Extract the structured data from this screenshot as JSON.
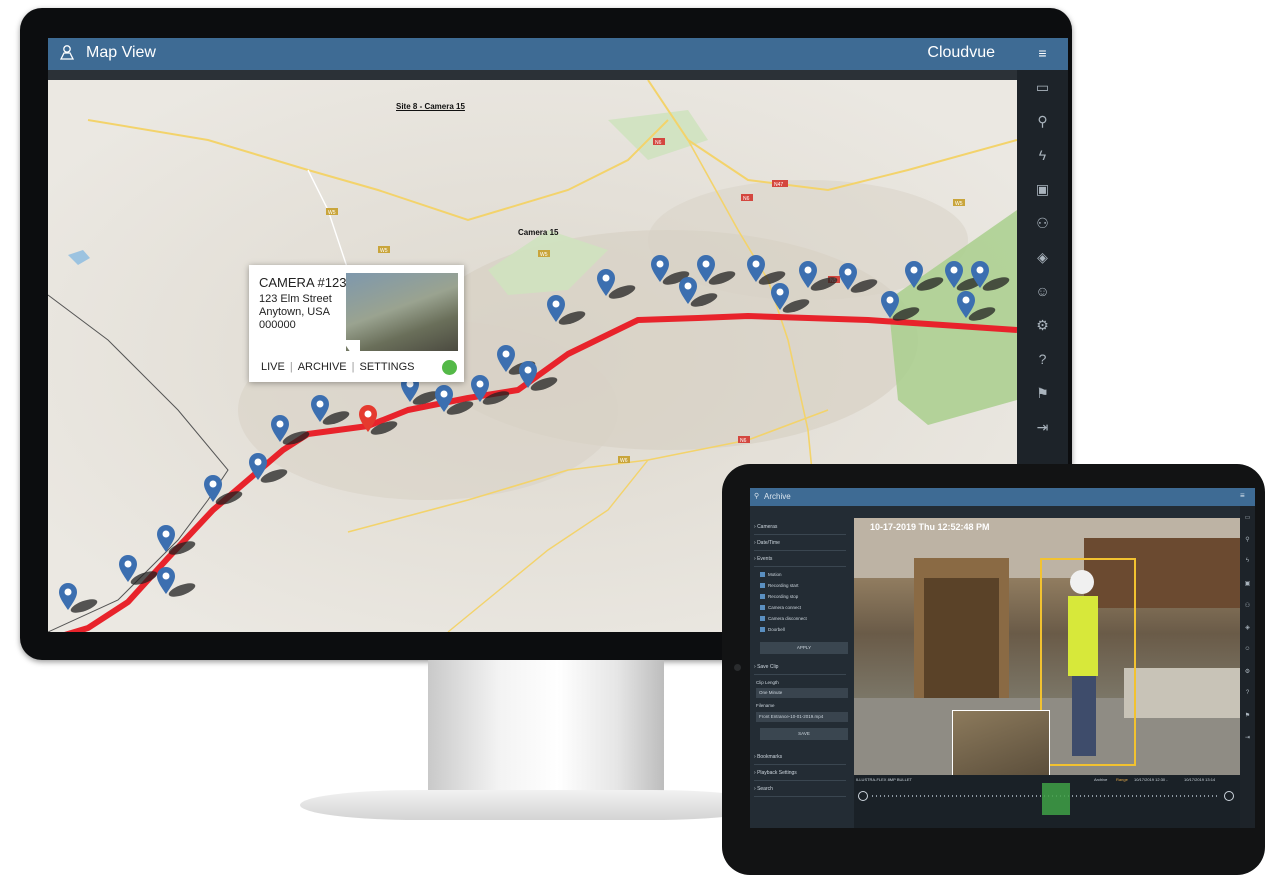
{
  "monitor": {
    "header": {
      "title": "Map View",
      "brand": "Cloudvue",
      "menu_icon": "hamburger-icon",
      "title_icon": "user-pin-icon"
    },
    "sidebar_icons": [
      "monitor-icon",
      "search-icon",
      "lightning-icon",
      "chart-icon",
      "user-pin-icon",
      "layers-icon",
      "user-circle-icon",
      "gear-icon",
      "help-icon",
      "flag-icon",
      "logout-icon"
    ],
    "map": {
      "labels": [
        {
          "text": "Site 8 - Camera 15"
        },
        {
          "text": "Camera 15"
        }
      ],
      "road_labels": [
        "W5",
        "W5",
        "W5",
        "N6",
        "N6",
        "N6",
        "N47",
        "N5",
        "W5",
        "W6"
      ],
      "route_color": "#e8232b",
      "pin_color": "#3c6fb0",
      "selected_pin_color": "#e53a2f"
    },
    "popup": {
      "camera": "CAMERA #123",
      "address_line1": "123 Elm Street",
      "address_line2": "Anytown, USA",
      "address_line3": "000000",
      "link_live": "LIVE",
      "link_archive": "ARCHIVE",
      "link_settings": "SETTINGS",
      "status_color": "#54b948"
    }
  },
  "tablet": {
    "header": {
      "title": "Archive",
      "title_icon": "search-icon",
      "menu_icon": "hamburger-icon"
    },
    "left_panel": {
      "sections": [
        "Cameras",
        "Date/Time",
        "Events"
      ],
      "events": [
        "Motion",
        "Recording start",
        "Recording stop",
        "Camera connect",
        "Camera disconnect",
        "Doorbell"
      ],
      "apply_button": "APPLY",
      "save_clip_section": "Save Clip",
      "clip_length_label": "Clip Length",
      "clip_length_value": "One Minute",
      "filename_label": "Filename",
      "filename_value": "Front Entrance-10-01-2019.mp4",
      "save_button": "SAVE",
      "more_sections": [
        "Bookmarks",
        "Playback Settings",
        "Search"
      ]
    },
    "video": {
      "timestamp": "10-17-2019  Thu  12:52:48 PM",
      "camera_name": "ILLUSTRA-FLEX 8MP BULLET",
      "mode": "Archive",
      "range_label": "Range",
      "range_start": "10/17/2019 12:30 -",
      "range_end": "10/17/2019 13:14"
    },
    "right_icons": [
      "monitor-icon",
      "search-icon",
      "lightning-icon",
      "chart-icon",
      "user-pin-icon",
      "layers-icon",
      "user-circle-icon",
      "gear-icon",
      "help-icon",
      "flag-icon",
      "logout-icon"
    ]
  }
}
